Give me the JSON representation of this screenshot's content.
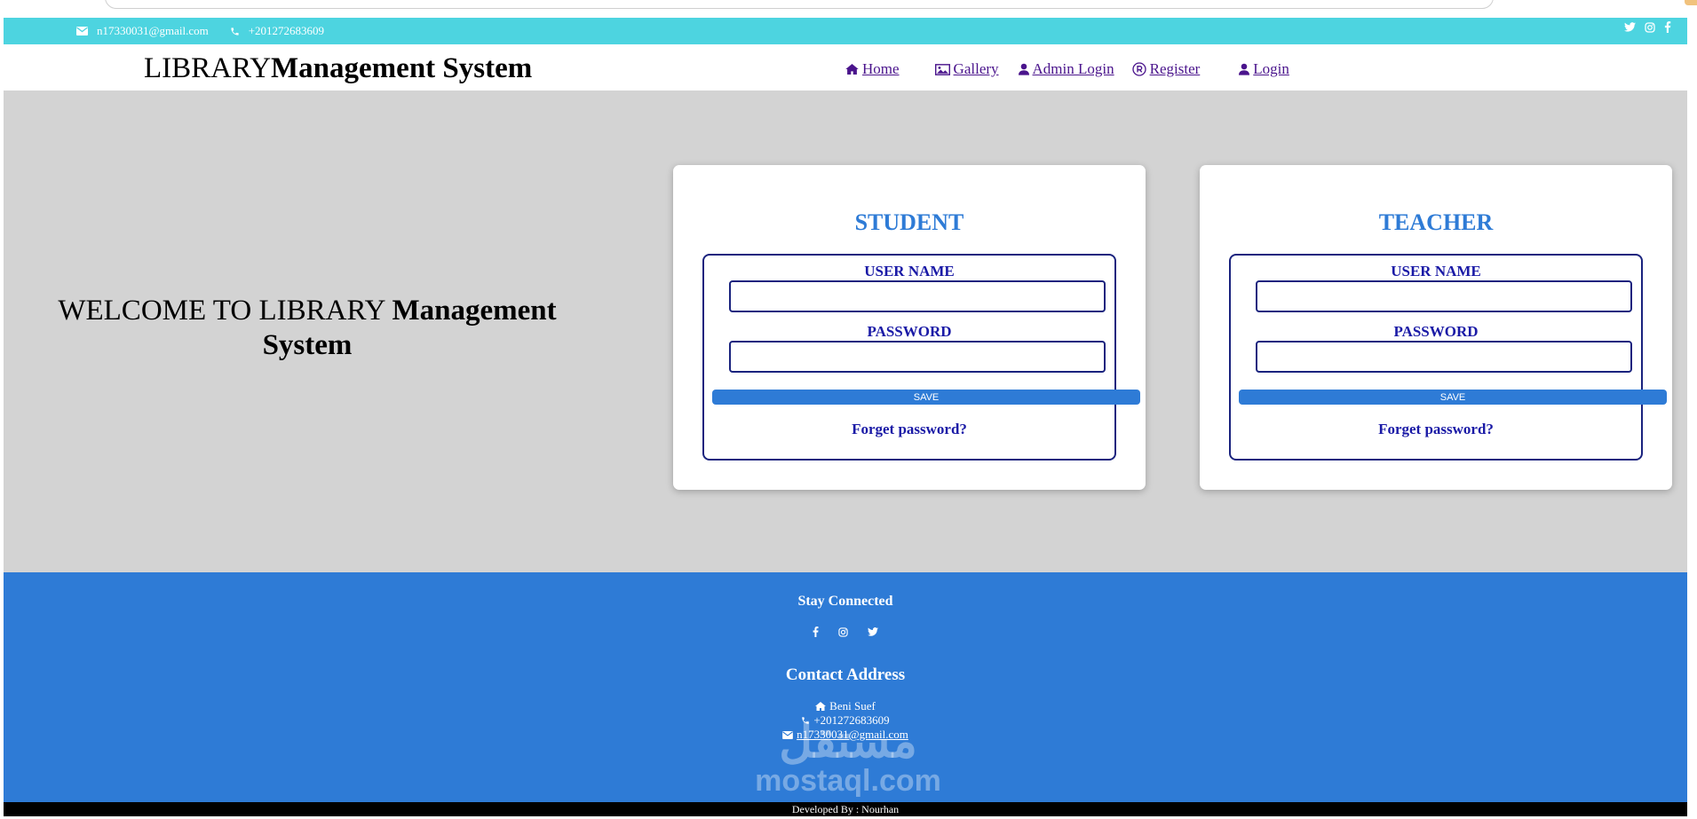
{
  "topbar": {
    "email": "n17330031@gmail.com",
    "phone": "+201272683609",
    "social_icons": [
      "twitter-icon",
      "instagram-icon",
      "facebook-icon"
    ]
  },
  "header": {
    "brand_prefix": "LIBRARY",
    "brand_bold": "Management System",
    "nav": {
      "home": "Home",
      "gallery": "Gallery",
      "admin_login": "Admin Login",
      "register": "Register",
      "login": "Login"
    }
  },
  "hero": {
    "welcome_prefix": "WELCOME TO LIBRARY ",
    "welcome_bold": "Management System"
  },
  "student_card": {
    "title": "STUDENT",
    "username_label": "USER NAME",
    "password_label": "PASSWORD",
    "username_value": "",
    "password_value": "",
    "save_label": "SAVE",
    "forgot_label": "Forget password?"
  },
  "teacher_card": {
    "title": "TEACHER",
    "username_label": "USER NAME",
    "password_label": "PASSWORD",
    "username_value": "",
    "password_value": "",
    "save_label": "SAVE",
    "forgot_label": "Forget password?"
  },
  "footer": {
    "stay_connected": "Stay Connected",
    "social_icons": [
      "facebook-icon",
      "instagram-icon",
      "twitter-icon"
    ],
    "contact_heading": "Contact Address",
    "address": "Beni Suef",
    "phone": "+201272683609",
    "email": "n17330031@gmail.com",
    "developed_by": "Developed By : Nourhan"
  },
  "watermark": {
    "arabic": "مستقل",
    "latin": "mostaql.com"
  },
  "colors": {
    "topbar": "#4dd4e0",
    "hero_bg": "#d3d3d3",
    "accent_blue": "#2e7bd6",
    "nav_link": "#4a148c",
    "form_border": "#1a237e"
  }
}
